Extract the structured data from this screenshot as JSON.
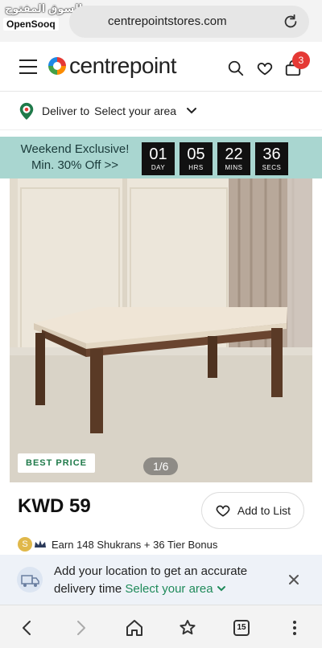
{
  "browser": {
    "watermark_arabic": "السوق المفتوح",
    "watermark_brand": "OpenSooq",
    "url": "centrepointstores.com"
  },
  "header": {
    "brand": "centrepoint",
    "cart_count": "3"
  },
  "delivery": {
    "label": "Deliver to",
    "value": "Select your area"
  },
  "promo": {
    "line1": "Weekend Exclusive!",
    "line2": "Min. 30% Off >>",
    "countdown": [
      {
        "value": "01",
        "label": "DAY"
      },
      {
        "value": "05",
        "label": "HRS"
      },
      {
        "value": "22",
        "label": "MINS"
      },
      {
        "value": "36",
        "label": "SECS"
      }
    ]
  },
  "product": {
    "badge": "BEST PRICE",
    "image_counter": "1/6",
    "price": "KWD 59",
    "add_to_list_label": "Add to List",
    "shukran_badge": "S",
    "shukran_text": "Earn 148 Shukrans + 36  Tier Bonus"
  },
  "location_prompt": {
    "line1": "Add your location to get an accurate",
    "line2_prefix": "delivery time",
    "link": "Select your area"
  },
  "bottom_nav": {
    "tab_count": "15"
  },
  "colors": {
    "promo_bg": "#a9d6d0",
    "accent_red": "#e53935",
    "link_green": "#1f8a5a"
  }
}
